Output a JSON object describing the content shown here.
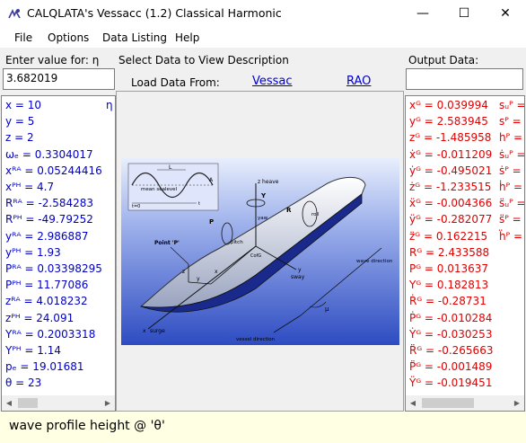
{
  "window": {
    "title": "CALQLATA's  Vessacc (1.2)  Classical Harmonic",
    "minimize_glyph": "—",
    "maximize_glyph": "☐",
    "close_glyph": "✕"
  },
  "menu": [
    "File",
    "Options",
    "Data Listing",
    "Help"
  ],
  "input": {
    "label": "Enter value for: η",
    "value": "3.682019"
  },
  "center": {
    "select_label": "Select Data to View Description",
    "load_label": "Load Data From:",
    "link_vessac": "Vessac",
    "link_rao": "RAO"
  },
  "output": {
    "label": "Output Data:",
    "value": ""
  },
  "left_list": [
    "x = 10",
    "y = 5",
    "z = 2",
    "ωₑ = 0.3304017",
    "xᴿᴬ = 0.05244416",
    "xᴾᴴ = 4.7",
    "Rᴿᴬ = -2.584283",
    "Rᴾᴴ = -49.79252",
    "yᴿᴬ = 2.986887",
    "yᴾᴴ = 1.93",
    "Pᴿᴬ = 0.03398295",
    "Pᴾᴴ = 11.77086",
    "zᴿᴬ = 4.018232",
    "zᴾᴴ = 24.091",
    "Yᴿᴬ = 0.2003318",
    "Yᴾᴴ = 1.14",
    "pₑ = 19.01681",
    "θ = 23"
  ],
  "left_list_extra": "η",
  "right_list": [
    "xᴳ = 0.039994",
    "yᴳ = 2.583945",
    "zᴳ = -1.485958",
    "ẋᴳ = -0.011209",
    "ẏᴳ = -0.495021",
    "żᴳ = -1.233515",
    "ẍᴳ = -0.004366",
    "ÿᴳ = -0.282077",
    "z̈ᴳ = 0.162215",
    "Rᴳ = 2.433588",
    "Pᴳ = 0.013637",
    "Yᴳ = 0.182813",
    "Ṙᴳ = -0.28731",
    "Ṗᴳ = -0.010284",
    "Ẏᴳ = -0.030253",
    "R̈ᴳ = -0.265663",
    "P̈ᴳ = -0.001489",
    "Ÿᴳ = -0.019451"
  ],
  "right_list_col2": [
    "sᵤᴾ =",
    "sᴾ =",
    "hᴾ =",
    "ṡᵤᴾ =",
    "ṡᴾ =",
    "ḣᴾ =",
    "s̈ᵤᴾ =",
    "s̈ᴾ =",
    "ḧᴾ ="
  ],
  "figure": {
    "mean_sealevel": "mean sealevel",
    "L": "L",
    "A": "A",
    "t0": "t=0",
    "t": "t",
    "heave": "z heave",
    "pitch": "pitch",
    "yaw": "yaw",
    "roll": "roll",
    "P": "P",
    "R": "R",
    "Y": "Y",
    "cofg": "CofG",
    "point_p": "Point 'P'",
    "z": "z",
    "y": "y",
    "x": "x",
    "sway": "sway",
    "y_axis": "y",
    "surge": "surge",
    "x_axis": "x",
    "wave_direction": "wave direction",
    "mu": "μ",
    "vessel_direction": "vessel direction"
  },
  "status": "wave profile height @ 'θ'",
  "colors": {
    "left_text": "#0000c8",
    "right_text": "#e00000",
    "link": "#0000cc",
    "status_bg": "#ffffe3",
    "figure_bg_top": "#ffffff",
    "figure_bg_bottom": "#3a56c8"
  }
}
